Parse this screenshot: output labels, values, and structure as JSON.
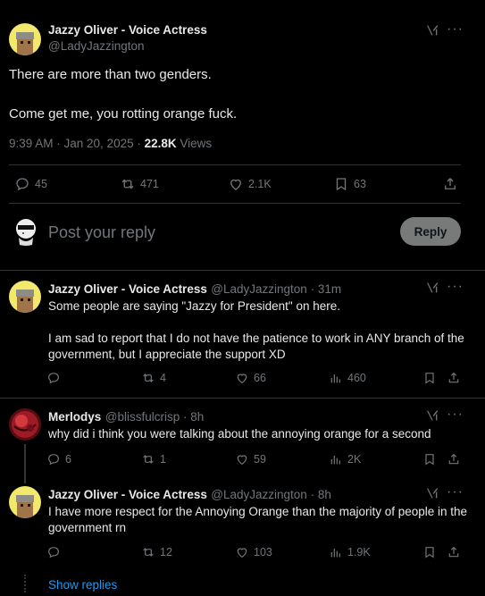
{
  "main_post": {
    "display_name": "Jazzy Oliver - Voice Actress",
    "handle": "@LadyJazzington",
    "text_line1": "There are more than two genders.",
    "text_line2": "Come get me, you rotting orange fuck.",
    "timestamp": "9:39 AM · Jan 20, 2025 · ",
    "views_count": "22.8K",
    "views_label": " Views",
    "replies": "45",
    "reposts": "471",
    "likes": "2.1K",
    "bookmarks": "63"
  },
  "composer": {
    "placeholder": "Post your reply",
    "reply_button": "Reply"
  },
  "replies": [
    {
      "display_name": "Jazzy Oliver - Voice Actress",
      "handle_time": "@LadyJazzington · 31m",
      "text": "Some people are saying \"Jazzy for President\" on here.\n\nI am sad to report that I do not have the patience to work in ANY branch of the government, but I appreciate the support XD",
      "replies": "",
      "reposts": "4",
      "likes": "66",
      "views": "460"
    },
    {
      "display_name": "Merlodys",
      "handle_time": "@blissfulcrisp · 8h",
      "text": "why did i think you were talking about the annoying orange for a second",
      "replies": "6",
      "reposts": "1",
      "likes": "59",
      "views": "2K"
    },
    {
      "display_name": "Jazzy Oliver - Voice Actress",
      "handle_time": "@LadyJazzington · 8h",
      "text": "I have more respect for the Annoying Orange than the majority of people in the government rn",
      "replies": "",
      "reposts": "12",
      "likes": "103",
      "views": "1.9K"
    }
  ],
  "show_replies": "Show replies",
  "colors": {
    "accent": "#1d9bf0",
    "muted": "#71767b",
    "divider": "#2f3336"
  },
  "icons": [
    "reply-icon",
    "repost-icon",
    "like-icon",
    "bookmark-icon",
    "share-icon",
    "views-icon",
    "grok-icon",
    "more-icon"
  ]
}
